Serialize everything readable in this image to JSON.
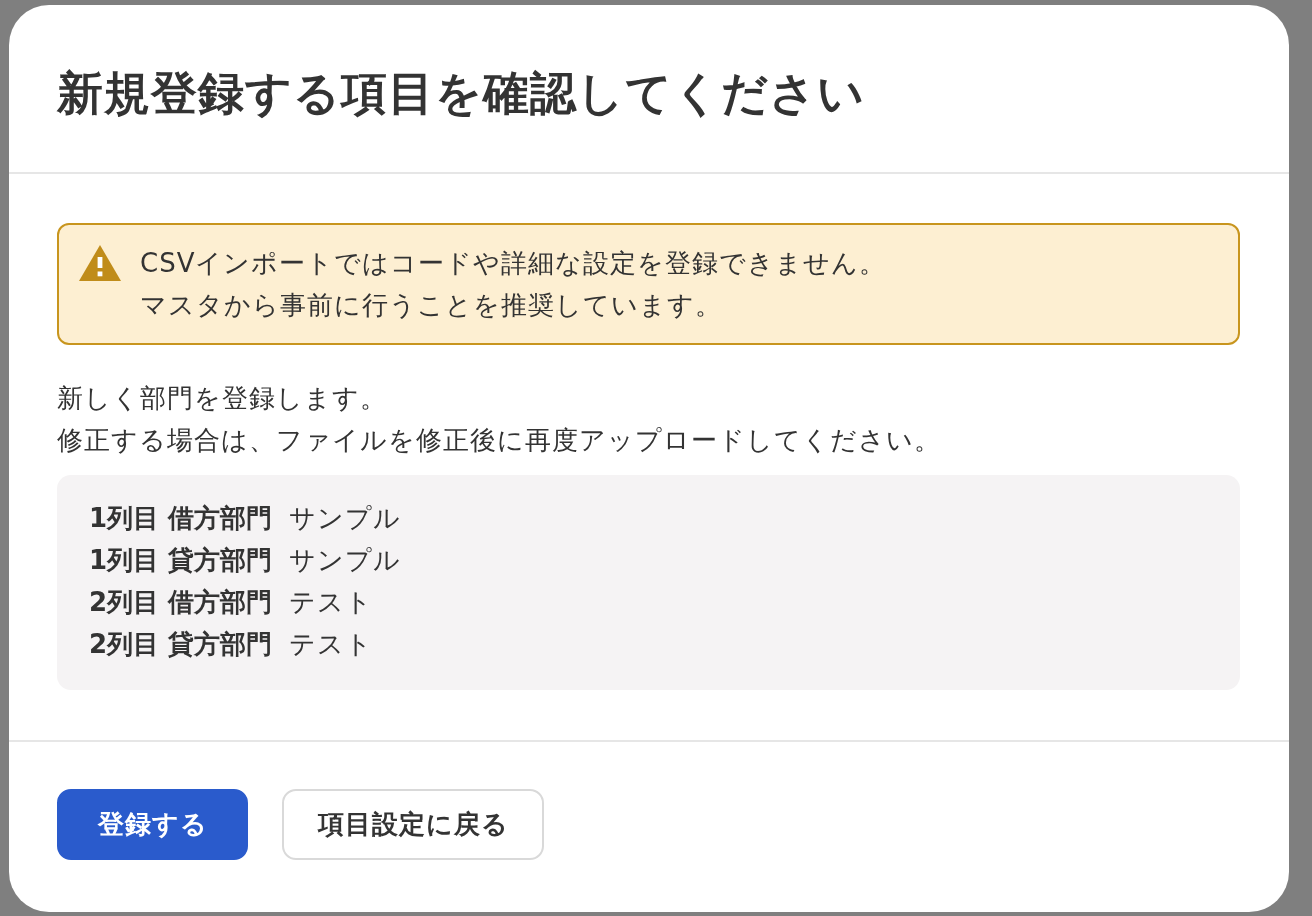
{
  "dialog": {
    "title": "新規登録する項目を確認してください",
    "alert": {
      "kind": "warning",
      "lines": [
        "CSVインポートではコードや詳細な設定を登録できません。",
        "マスタから事前に行うことを推奨しています。"
      ]
    },
    "description": [
      "新しく部門を登録します。",
      "修正する場合は、ファイルを修正後に再度アップロードしてください。"
    ],
    "items": [
      {
        "label": "1列目 借方部門",
        "value": "サンプル"
      },
      {
        "label": "1列目 貸方部門",
        "value": "サンプル"
      },
      {
        "label": "2列目 借方部門",
        "value": "テスト"
      },
      {
        "label": "2列目 貸方部門",
        "value": "テスト"
      }
    ],
    "buttons": [
      {
        "label": "登録する",
        "kind": "primary"
      },
      {
        "label": "項目設定に戻る",
        "kind": "secondary"
      }
    ]
  }
}
